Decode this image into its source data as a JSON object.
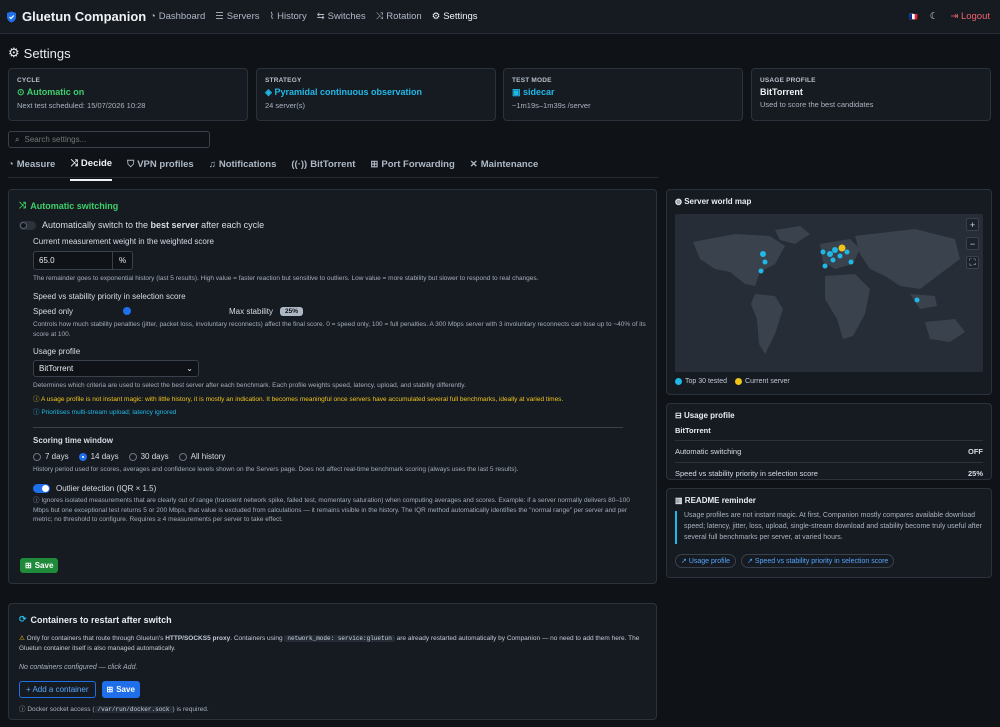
{
  "nav": {
    "brand": "Gluetun Companion",
    "links": [
      "Dashboard",
      "Servers",
      "History",
      "Switches",
      "Rotation",
      "Settings"
    ],
    "flag": "🇫🇷",
    "logout": "Logout"
  },
  "page_title": "Settings",
  "summary": {
    "cycle": {
      "label": "CYCLE",
      "value": "Automatic on",
      "sub": "Next test scheduled: 15/07/2026 10:28"
    },
    "strategy": {
      "label": "STRATEGY",
      "value": "Pyramidal continuous observation",
      "sub": "24 server(s)"
    },
    "test_mode": {
      "label": "TEST MODE",
      "value": "sidecar",
      "sub": "~1m19s–1m39s /server"
    },
    "usage_profile": {
      "label": "USAGE PROFILE",
      "value": "BitTorrent",
      "sub": "Used to score the best candidates"
    }
  },
  "search": {
    "placeholder": "Search settings..."
  },
  "tabs": [
    "Measure",
    "Decide",
    "VPN profiles",
    "Notifications",
    "BitTorrent",
    "Port Forwarding",
    "Maintenance"
  ],
  "auto": {
    "title": "Automatic switching",
    "toggle_pre": "Automatically switch to the ",
    "toggle_bold": "best server",
    "toggle_post": " after each cycle",
    "weight_label": "Current measurement weight in the weighted score",
    "weight_value": "65.0",
    "weight_unit": "%",
    "weight_help": "The remainder goes to exponential history (last 5 results). High value = faster reaction but sensitive to outliers. Low value = more stability but slower to respond to real changes.",
    "priority_label": "Speed vs stability priority in selection score",
    "priority_left": "Speed only",
    "priority_right": "Max stability",
    "priority_badge": "25%",
    "priority_value": 25,
    "priority_help": "Controls how much stability penalties (jitter, packet loss, involuntary reconnects) affect the final score. 0 = speed only, 100 = full penalties. A 300 Mbps server with 3 involuntary reconnects can lose up to ~40% of its score at 100.",
    "usage_label": "Usage profile",
    "usage_value": "BitTorrent",
    "usage_help": "Determines which criteria are used to select the best server after each benchmark. Each profile weights speed, latency, upload, and stability differently.",
    "usage_warn": "A usage profile is not instant magic: with little history, it is mostly an indication. It becomes meaningful once servers have accumulated several full benchmarks, ideally at varied times.",
    "usage_info": "Prioritises multi-stream upload; latency ignored",
    "window_label": "Scoring time window",
    "window_options": [
      "7 days",
      "14 days",
      "30 days",
      "All history"
    ],
    "window_help": "History period used for scores, averages and confidence levels shown on the Servers page. Does not affect real-time benchmark scoring (always uses the last 5 results).",
    "outlier_label": "Outlier detection (IQR × 1.5)",
    "outlier_help": "Ignores isolated measurements that are clearly out of range (transient network spike, failed test, momentary saturation) when computing averages and scores. Example: if a server normally delivers 80–100 Mbps but one exceptional test returns 5 or 200 Mbps, that value is excluded from calculations — it remains visible in the history. The IQR method automatically identifies the \"normal range\" per server and per metric; no threshold to configure. Requires ≥ 4 measurements per server to take effect.",
    "save": "Save"
  },
  "containers": {
    "title": "Containers to restart after switch",
    "warn_pre": "Only for containers that route through Gluetun's ",
    "warn_bold": "HTTP/SOCKS5 proxy",
    "warn_mid": ". Containers using ",
    "warn_code": "network_mode: service:gluetun",
    "warn_post": " are already restarted automatically by Companion — no need to add them here. The Gluetun container itself is also managed automatically.",
    "empty": "No containers configured — click Add.",
    "add": "+ Add a container",
    "save": "Save",
    "socket_pre": "Docker socket access (",
    "socket_code": "/var/run/docker.sock",
    "socket_post": ") is required."
  },
  "map": {
    "title": "Server world map",
    "legend_top": "Top 30 tested",
    "legend_current": "Current server",
    "colors": {
      "top": "#20b8e6",
      "current": "#f0c419"
    }
  },
  "usage_card": {
    "title": "Usage profile",
    "profile": "BitTorrent",
    "rows": [
      {
        "label": "Automatic switching",
        "value": "OFF"
      },
      {
        "label": "Speed vs stability priority in selection score",
        "value": "25%"
      }
    ]
  },
  "readme": {
    "title": "README reminder",
    "text": "Usage profiles are not instant magic. At first, Companion mostly compares available download speed; latency, jitter, loss, upload, single-stream download and stability become truly useful after several full benchmarks per server, at varied hours.",
    "chips": [
      "Usage profile",
      "Speed vs stability priority in selection score"
    ]
  }
}
